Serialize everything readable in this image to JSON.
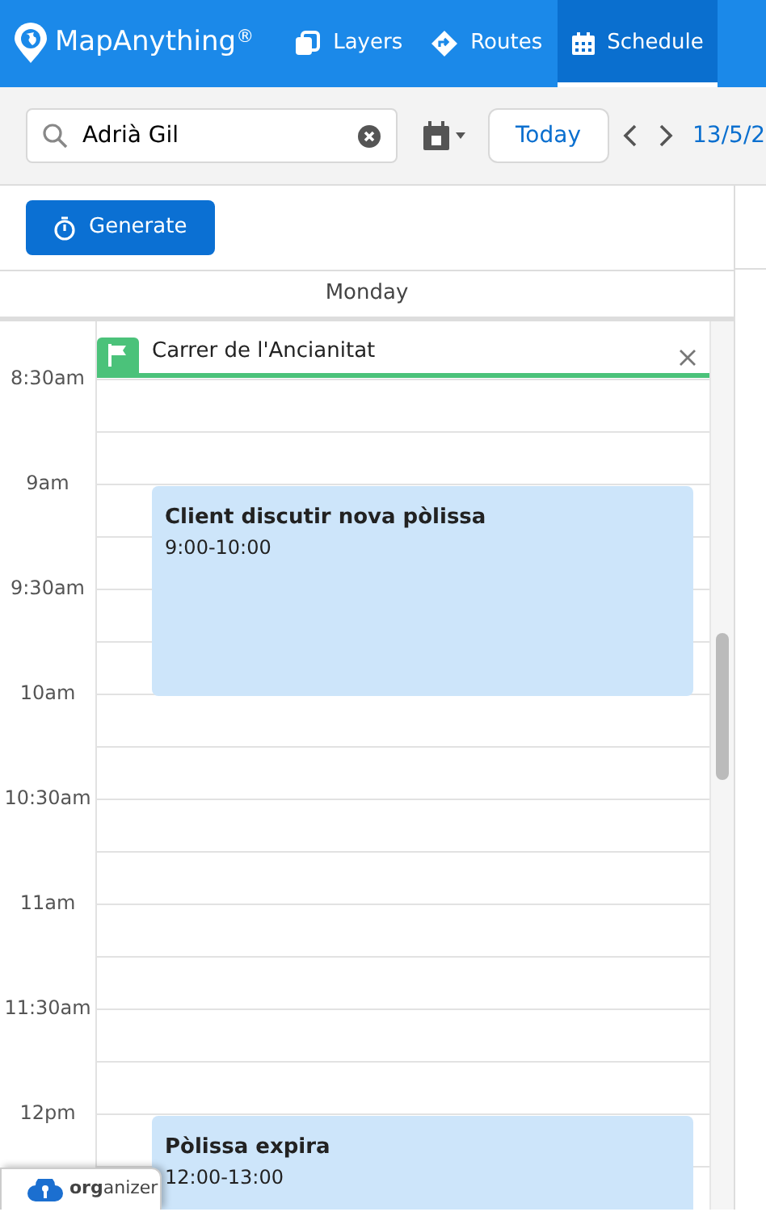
{
  "navbar": {
    "brand": "MapAnything",
    "brand_mark": "®",
    "tabs": [
      {
        "label": "Layers",
        "selected": false,
        "kind": "layers"
      },
      {
        "label": "Routes",
        "selected": false,
        "kind": "routes"
      },
      {
        "label": "Schedule",
        "selected": true,
        "kind": "schedule"
      }
    ]
  },
  "toolbar": {
    "search": {
      "value": "Adrià Gil"
    },
    "today": "Today",
    "date": "13/5/2"
  },
  "generate": "Generate",
  "day_header": "Monday",
  "time_labels": [
    "8:30am",
    "9am",
    "9:30am",
    "10am",
    "10:30am",
    "11am",
    "11:30am",
    "12pm"
  ],
  "events": [
    {
      "kind": "flag",
      "title": "Carrer de l'Ancianitat"
    },
    {
      "kind": "appointment",
      "title": "Client discutir nova pòlissa",
      "time": "9:00-10:00"
    },
    {
      "kind": "appointment",
      "title": "Pòlissa expira",
      "time": "12:00-13:00"
    }
  ],
  "organizer": {
    "bold": "org",
    "rest": "anizer"
  }
}
